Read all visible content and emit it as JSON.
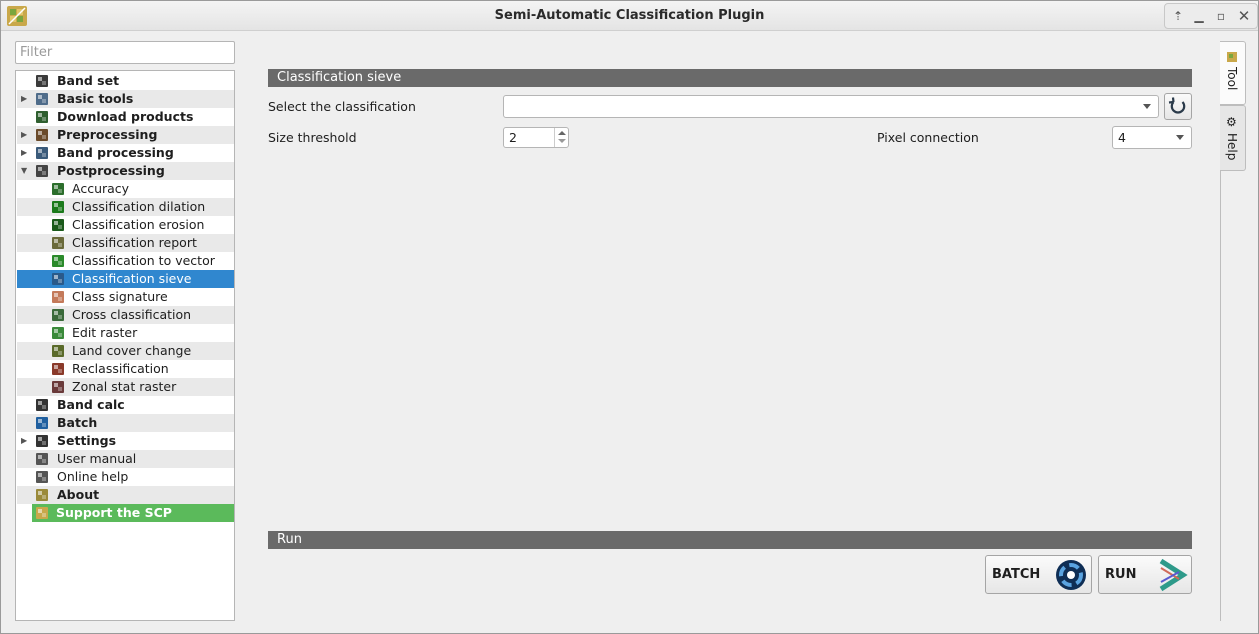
{
  "window": {
    "title": "Semi-Automatic Classification Plugin",
    "controls": [
      "pin-icon",
      "minimize-icon",
      "maximize-icon",
      "close-icon"
    ]
  },
  "filter": {
    "placeholder": "Filter"
  },
  "tree": {
    "items": [
      {
        "label": "Band set",
        "level": 0,
        "expander": "",
        "icon": "band-set-icon",
        "bold": true
      },
      {
        "label": "Basic tools",
        "level": 0,
        "expander": "▶",
        "icon": "basic-tools-icon",
        "bold": true
      },
      {
        "label": "Download products",
        "level": 0,
        "expander": "",
        "icon": "download-icon",
        "bold": true
      },
      {
        "label": "Preprocessing",
        "level": 0,
        "expander": "▶",
        "icon": "preprocessing-icon",
        "bold": true
      },
      {
        "label": "Band processing",
        "level": 0,
        "expander": "▶",
        "icon": "band-processing-icon",
        "bold": true
      },
      {
        "label": "Postprocessing",
        "level": 0,
        "expander": "▼",
        "icon": "postprocessing-icon",
        "bold": true
      },
      {
        "label": "Accuracy",
        "level": 1,
        "icon": "accuracy-icon"
      },
      {
        "label": "Classification dilation",
        "level": 1,
        "icon": "dilation-icon"
      },
      {
        "label": "Classification erosion",
        "level": 1,
        "icon": "erosion-icon"
      },
      {
        "label": "Classification report",
        "level": 1,
        "icon": "report-icon"
      },
      {
        "label": "Classification to vector",
        "level": 1,
        "icon": "to-vector-icon"
      },
      {
        "label": "Classification sieve",
        "level": 1,
        "icon": "sieve-icon",
        "selected": true
      },
      {
        "label": "Class signature",
        "level": 1,
        "icon": "signature-icon"
      },
      {
        "label": "Cross classification",
        "level": 1,
        "icon": "cross-icon"
      },
      {
        "label": "Edit raster",
        "level": 1,
        "icon": "edit-raster-icon"
      },
      {
        "label": "Land cover change",
        "level": 1,
        "icon": "land-cover-icon"
      },
      {
        "label": "Reclassification",
        "level": 1,
        "icon": "reclass-icon"
      },
      {
        "label": "Zonal stat raster",
        "level": 1,
        "icon": "zonal-icon"
      },
      {
        "label": "Band calc",
        "level": 0,
        "expander": "",
        "icon": "band-calc-icon",
        "bold": true
      },
      {
        "label": "Batch",
        "level": 0,
        "expander": "",
        "icon": "batch-icon",
        "bold": true
      },
      {
        "label": "Settings",
        "level": 0,
        "expander": "▶",
        "icon": "settings-icon",
        "bold": true
      },
      {
        "label": "User manual",
        "level": 0,
        "expander": "",
        "icon": "manual-icon",
        "bold": false
      },
      {
        "label": "Online help",
        "level": 0,
        "expander": "",
        "icon": "help-icon",
        "bold": false
      },
      {
        "label": "About",
        "level": 0,
        "expander": "",
        "icon": "about-icon",
        "bold": true
      },
      {
        "label": "Support the SCP",
        "level": 0,
        "expander": "",
        "icon": "scp-icon",
        "bold": true,
        "support": true
      }
    ]
  },
  "main": {
    "section_title": "Classification sieve",
    "select_label": "Select the classification",
    "select_value": "",
    "threshold_label": "Size threshold",
    "threshold_value": "2",
    "connection_label": "Pixel connection",
    "connection_value": "4",
    "run_section_title": "Run",
    "batch_label": "BATCH",
    "run_label": "RUN"
  },
  "side_tabs": {
    "tool": "Tool",
    "help": "Help"
  },
  "colors": {
    "selected": "#3087cf",
    "support": "#5bba5b",
    "header": "#6a6a6a"
  }
}
